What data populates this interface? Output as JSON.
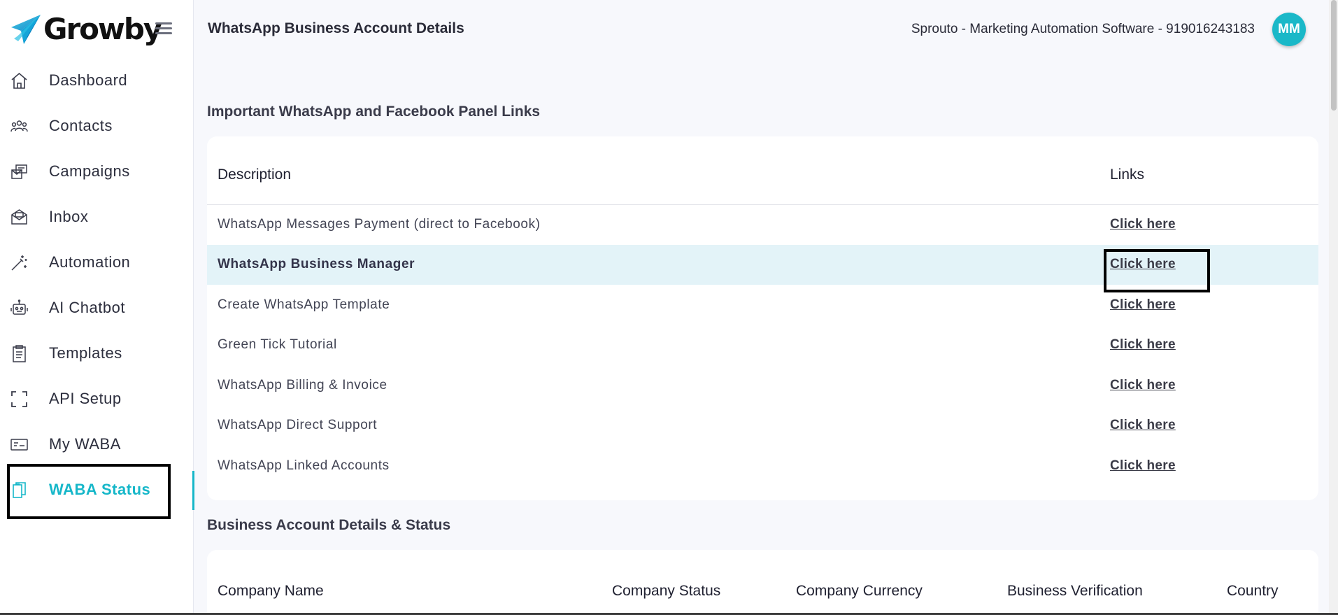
{
  "brand": {
    "name": "Growby",
    "accent": "#16b7c9"
  },
  "sidebar": {
    "items": [
      {
        "label": "Dashboard",
        "icon": "home-icon"
      },
      {
        "label": "Contacts",
        "icon": "contacts-icon"
      },
      {
        "label": "Campaigns",
        "icon": "campaigns-icon"
      },
      {
        "label": "Inbox",
        "icon": "inbox-icon"
      },
      {
        "label": "Automation",
        "icon": "automation-wand-icon"
      },
      {
        "label": "AI Chatbot",
        "icon": "robot-icon"
      },
      {
        "label": "Templates",
        "icon": "clipboard-icon"
      },
      {
        "label": "API Setup",
        "icon": "frame-corners-icon"
      },
      {
        "label": "My WABA",
        "icon": "id-card-icon"
      },
      {
        "label": "WABA Status",
        "icon": "copy-clipboard-icon",
        "active": true
      }
    ]
  },
  "header": {
    "title": "WhatsApp Business Account Details",
    "account": "Sprouto - Marketing Automation Software - 919016243183",
    "avatar_initials": "MM"
  },
  "links_section": {
    "title": "Important WhatsApp and Facebook Panel Links",
    "columns": [
      "Description",
      "Links"
    ],
    "rows": [
      {
        "description": "WhatsApp Messages Payment (direct to Facebook)",
        "link": "Click here"
      },
      {
        "description": "WhatsApp Business Manager",
        "link": "Click here",
        "highlighted": true
      },
      {
        "description": "Create WhatsApp Template",
        "link": "Click here"
      },
      {
        "description": "Green Tick Tutorial",
        "link": "Click here"
      },
      {
        "description": "WhatsApp Billing & Invoice",
        "link": "Click here"
      },
      {
        "description": "WhatsApp Direct Support",
        "link": "Click here"
      },
      {
        "description": "WhatsApp Linked Accounts",
        "link": "Click here"
      }
    ]
  },
  "details_section": {
    "title": "Business Account Details & Status",
    "columns": [
      "Company Name",
      "Company Status",
      "Company Currency",
      "Business Verification",
      "Country"
    ]
  }
}
